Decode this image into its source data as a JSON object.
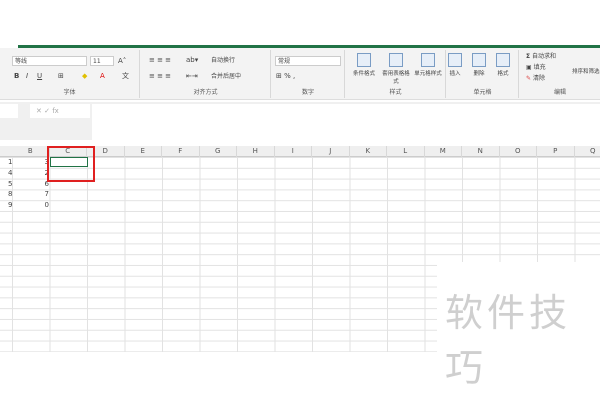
{
  "ribbon": {
    "font": {
      "name": "等线",
      "size": "11",
      "label": "字体"
    },
    "alignment": {
      "wrap": "自动换行",
      "merge": "合并后居中",
      "label": "对齐方式"
    },
    "number": {
      "format": "常规",
      "label": "数字"
    },
    "styles": {
      "conditional": "条件格式",
      "table": "套用表格格式",
      "cell": "单元格样式",
      "label": "样式"
    },
    "cells": {
      "insert": "插入",
      "delete": "删除",
      "format": "格式",
      "label": "单元格"
    },
    "editing": {
      "autosum": "自动求和",
      "fill": "填充",
      "clear": "清除",
      "sort": "排序和筛选",
      "label": "编辑"
    }
  },
  "formula_bar": {
    "fx": "fx"
  },
  "columns": [
    "B",
    "C",
    "D",
    "E",
    "F",
    "G",
    "H",
    "I",
    "J",
    "K",
    "L",
    "M",
    "N",
    "O",
    "P",
    "Q"
  ],
  "rows": [
    {
      "a": "1",
      "b": "3"
    },
    {
      "a": "4",
      "b": "2"
    },
    {
      "a": "5",
      "b": "6"
    },
    {
      "a": "8",
      "b": "7"
    },
    {
      "a": "9",
      "b": "0"
    }
  ],
  "watermark": "软件技巧",
  "colors": {
    "accent": "#217346",
    "highlight": "#e02020"
  }
}
